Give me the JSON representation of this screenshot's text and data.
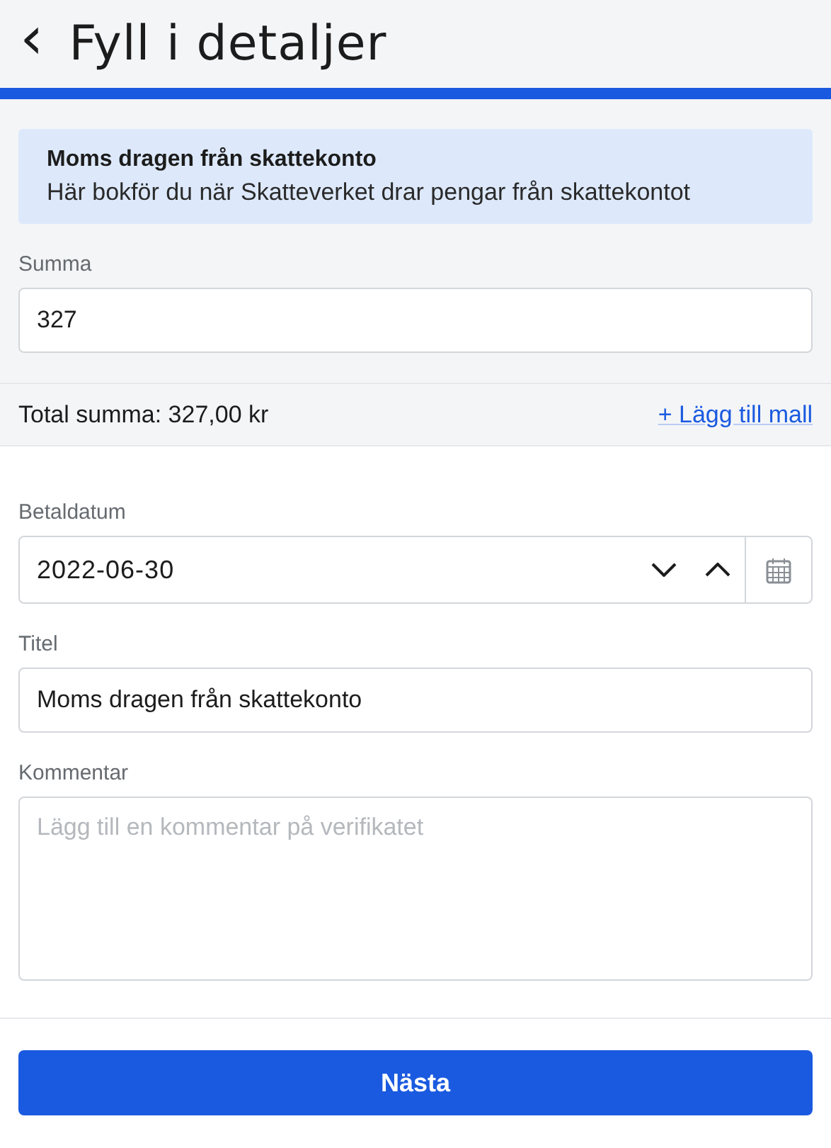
{
  "header": {
    "back": "‹",
    "title": "Fyll i detaljer"
  },
  "progress": {
    "level": 1
  },
  "info": {
    "title": "Moms dragen från skattekonto",
    "text": "Här bokför du när Skatteverket drar pengar från skattekontot"
  },
  "amount": {
    "label": "Summa",
    "value": "327"
  },
  "total": {
    "text": "Total summa: 327,00 kr",
    "link": "+ Lägg till mall"
  },
  "date": {
    "label": "Betaldatum",
    "value": "2022-06-30"
  },
  "title_field": {
    "label": "Titel",
    "value": "Moms dragen från skattekonto"
  },
  "comment": {
    "label": "Kommentar",
    "placeholder": "Lägg till en kommentar på verifikatet"
  },
  "button": "Nästa"
}
